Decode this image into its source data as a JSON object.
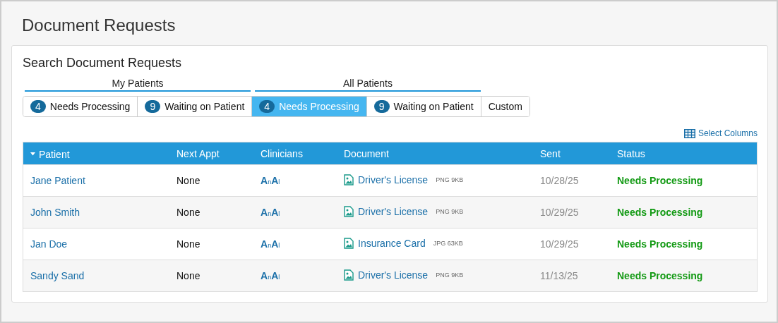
{
  "page_title": "Document Requests",
  "search": {
    "title": "Search Document Requests",
    "groups": [
      {
        "label": "My Patients",
        "tabs": [
          {
            "count": "4",
            "label": "Needs Processing",
            "selected": false
          },
          {
            "count": "9",
            "label": "Waiting on Patient",
            "selected": false
          }
        ]
      },
      {
        "label": "All Patients",
        "tabs": [
          {
            "count": "4",
            "label": "Needs Processing",
            "selected": true
          },
          {
            "count": "9",
            "label": "Waiting on Patient",
            "selected": false
          }
        ]
      }
    ],
    "extra_tab": {
      "label": "Custom",
      "selected": false
    }
  },
  "select_columns": "Select Columns",
  "table": {
    "columns": [
      {
        "label": "Patient",
        "sorted": true
      },
      {
        "label": "Next Appt",
        "sorted": false
      },
      {
        "label": "Clinicians",
        "sorted": false
      },
      {
        "label": "Document",
        "sorted": false
      },
      {
        "label": "Sent",
        "sorted": false
      },
      {
        "label": "Status",
        "sorted": false
      }
    ],
    "rows": [
      {
        "patient": "Jane Patient",
        "next_appt": "None",
        "clinicians": [
          {
            "big": "A",
            "small": "n"
          },
          {
            "big": "A",
            "small": "l"
          }
        ],
        "document": "Driver's License",
        "file_info": "PNG 9KB",
        "sent": "10/28/25",
        "status": "Needs Processing"
      },
      {
        "patient": "John Smith",
        "next_appt": "None",
        "clinicians": [
          {
            "big": "A",
            "small": "n"
          },
          {
            "big": "A",
            "small": "l"
          }
        ],
        "document": "Driver's License",
        "file_info": "PNG 9KB",
        "sent": "10/29/25",
        "status": "Needs Processing"
      },
      {
        "patient": "Jan Doe",
        "next_appt": "None",
        "clinicians": [
          {
            "big": "A",
            "small": "n"
          },
          {
            "big": "A",
            "small": "l"
          }
        ],
        "document": "Insurance Card",
        "file_info": "JPG 63KB",
        "sent": "10/29/25",
        "status": "Needs Processing"
      },
      {
        "patient": "Sandy Sand",
        "next_appt": "None",
        "clinicians": [
          {
            "big": "A",
            "small": "n"
          },
          {
            "big": "A",
            "small": "l"
          }
        ],
        "document": "Driver's License",
        "file_info": "PNG 9KB",
        "sent": "11/13/25",
        "status": "Needs Processing"
      }
    ]
  }
}
